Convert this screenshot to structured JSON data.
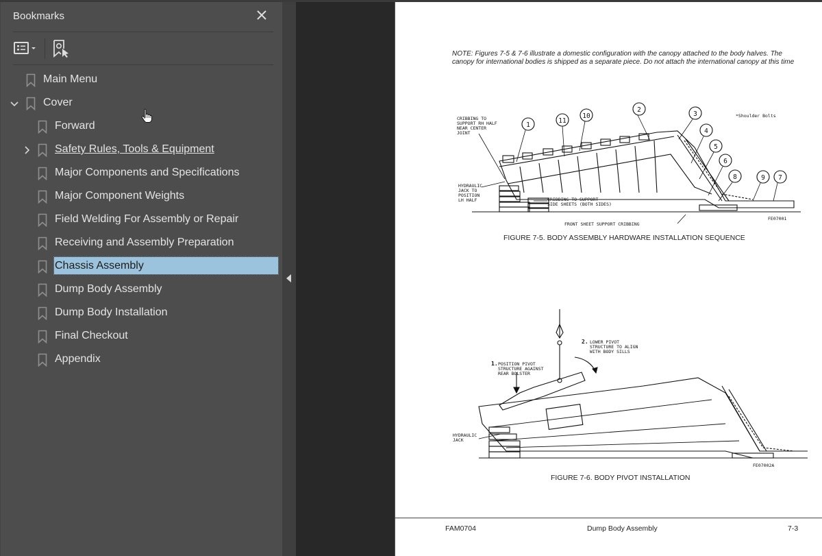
{
  "bookmarks_panel": {
    "title": "Bookmarks",
    "close_icon": "close-icon",
    "toolbar": {
      "options_button": "list-options-icon",
      "add_bookmark_button": "new-bookmark-icon"
    },
    "items": [
      {
        "label": "Main Menu",
        "level": 0,
        "expander": "none",
        "underline": false,
        "selected": false
      },
      {
        "label": "Cover",
        "level": 0,
        "expander": "expanded",
        "underline": false,
        "selected": false
      },
      {
        "label": "Forward",
        "level": 1,
        "expander": "none",
        "underline": false,
        "selected": false
      },
      {
        "label": "Safety Rules, Tools & Equipment",
        "level": 1,
        "expander": "collapsed",
        "underline": true,
        "selected": false
      },
      {
        "label": "Major Components and Specifications",
        "level": 1,
        "expander": "none",
        "underline": false,
        "selected": false
      },
      {
        "label": "Major Component Weights",
        "level": 1,
        "expander": "none",
        "underline": false,
        "selected": false
      },
      {
        "label": "Field Welding For Assembly or Repair",
        "level": 1,
        "expander": "none",
        "underline": false,
        "selected": false
      },
      {
        "label": "Receiving and Assembly Preparation",
        "level": 1,
        "expander": "none",
        "underline": false,
        "selected": false
      },
      {
        "label": "Chassis Assembly",
        "level": 1,
        "expander": "none",
        "underline": false,
        "selected": true
      },
      {
        "label": "Dump Body Assembly",
        "level": 1,
        "expander": "none",
        "underline": false,
        "selected": false
      },
      {
        "label": "Dump Body Installation",
        "level": 1,
        "expander": "none",
        "underline": false,
        "selected": false
      },
      {
        "label": "Final Checkout",
        "level": 1,
        "expander": "none",
        "underline": false,
        "selected": false
      },
      {
        "label": "Appendix",
        "level": 1,
        "expander": "none",
        "underline": false,
        "selected": false
      }
    ],
    "selected_color": "#9cc3de"
  },
  "document": {
    "note": "NOTE: Figures 7-5 & 7-6 illustrate a domestic configuration with the canopy attached to the body halves. The canopy for international bodies is shipped as a separate piece. Do not attach the international canopy at this time",
    "figure_7_5": {
      "caption": "FIGURE 7-5. BODY ASSEMBLY HARDWARE INSTALLATION SEQUENCE",
      "drawing_id": "FE07001",
      "legend_note": "*Shoulder Bolts",
      "callouts": [
        "1*",
        "11",
        "10",
        "2*",
        "3",
        "4",
        "5",
        "6",
        "8",
        "9",
        "7*"
      ],
      "labels": {
        "cribbing_rh": [
          "CRIBBING TO",
          "SUPPORT RH HALF",
          "NEAR CENTER",
          "JOINT"
        ],
        "hydraulic_jack": [
          "HYDRAULIC",
          "JACK TO",
          "POSITION",
          "LH HALF"
        ],
        "cribbing_side": [
          "CRIBBING TO SUPPORT",
          "SIDE SHEETS (BOTH SIDES)"
        ],
        "front_sheet": "FRONT SHEET SUPPORT CRIBBING"
      }
    },
    "figure_7_6": {
      "caption": "FIGURE 7-6. BODY PIVOT INSTALLATION",
      "drawing_id": "FE07002A",
      "labels": {
        "step1_num": "1.",
        "step1": [
          "POSITION PIVOT",
          "STRUCTURE AGAINST",
          "REAR BOLSTER"
        ],
        "step2_num": "2.",
        "step2": [
          "LOWER PIVOT",
          "STRUCTURE TO ALIGN",
          "WITH BODY SILLS"
        ],
        "hydraulic_jack": [
          "HYDRAULIC",
          "JACK"
        ]
      }
    },
    "footer": {
      "left": "FAM0704",
      "center": "Dump Body Assembly",
      "right": "7-3"
    }
  }
}
